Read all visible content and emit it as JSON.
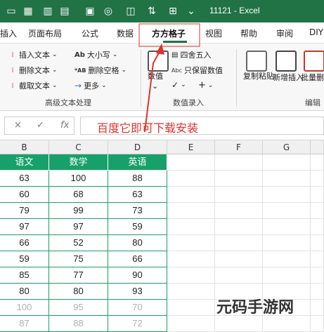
{
  "titlebar": {
    "title": "11121 - Excel",
    "bg_color": "#217346"
  },
  "tabs": [
    {
      "label": "插入"
    },
    {
      "label": "页面布局"
    },
    {
      "label": "公式"
    },
    {
      "label": "数据"
    },
    {
      "label": "方方格子",
      "active": true
    },
    {
      "label": "视图"
    },
    {
      "label": "帮助"
    },
    {
      "label": "审阅"
    },
    {
      "label": "DIY"
    }
  ],
  "ribbon": {
    "text_group": {
      "insert_text": "插入文本",
      "delete_text": "删除文本",
      "cut_text": "截取文本",
      "case": "大小写",
      "delete_space": "删除空格",
      "more": "更多",
      "group_label": "高级文本处理"
    },
    "number_group": {
      "value": "数值",
      "round": "四舍五入",
      "keep_numbers": "只保留数值",
      "group_label": "数值录入"
    },
    "edit_group": {
      "copy_paste": "复制粘贴",
      "new_insert": "新增插入",
      "batch_delete": "批量删除",
      "group_label": "编辑"
    }
  },
  "formula_bar": {
    "cancel_glyph": "×",
    "confirm_glyph": "✓",
    "fx_label": "fx",
    "content": "百度它即可下载安装"
  },
  "sheet": {
    "columns": [
      "B",
      "C",
      "D",
      "E",
      "F",
      "G"
    ],
    "headers": [
      "语文",
      "数学",
      "英语"
    ],
    "rows": [
      [
        "63",
        "100",
        "88"
      ],
      [
        "60",
        "68",
        "63"
      ],
      [
        "79",
        "99",
        "73"
      ],
      [
        "97",
        "97",
        "59"
      ],
      [
        "66",
        "52",
        "80"
      ],
      [
        "59",
        "75",
        "66"
      ],
      [
        "85",
        "77",
        "90"
      ],
      [
        "80",
        "80",
        "93"
      ],
      [
        "100",
        "95",
        "70"
      ],
      [
        "87",
        "88",
        "72"
      ]
    ],
    "header_color": "#18a06a"
  },
  "watermark": "元码手游网"
}
